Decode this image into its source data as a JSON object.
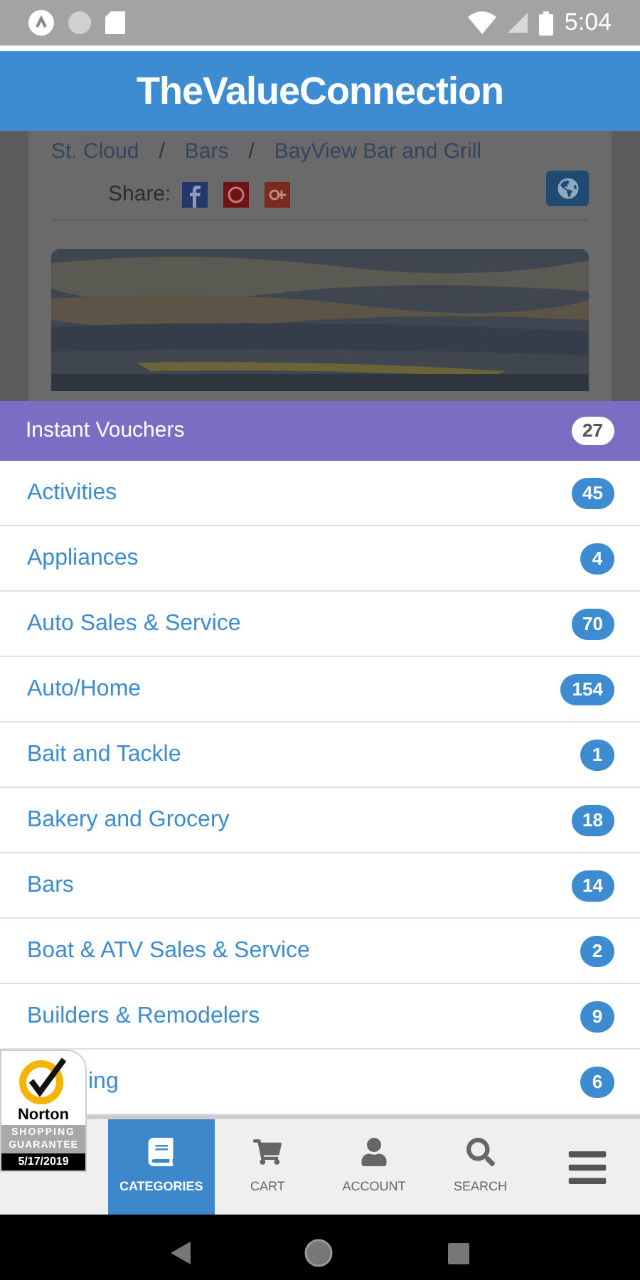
{
  "status_bar": {
    "time": "5:04"
  },
  "header": {
    "title": "TheValueConnection"
  },
  "background_page": {
    "breadcrumbs": [
      "St. Cloud",
      "Bars",
      "BayView Bar and Grill"
    ],
    "separator": "/",
    "share_label": "Share:"
  },
  "featured": {
    "label": "Instant Vouchers",
    "count": "27"
  },
  "categories": [
    {
      "label": "Activities",
      "count": "45",
      "kind": "full"
    },
    {
      "label": "Appliances",
      "count": "4",
      "kind": "full"
    },
    {
      "label": "Auto Sales & Service",
      "count": "70",
      "kind": "full"
    },
    {
      "label": "Auto/Home",
      "count": "154",
      "kind": "full"
    },
    {
      "label": "Bait and Tackle",
      "count": "1",
      "kind": "full"
    },
    {
      "label": "Bakery and Grocery",
      "count": "18",
      "kind": "full"
    },
    {
      "label": "Bars",
      "count": "14",
      "kind": "full"
    },
    {
      "label": "Boat & ATV Sales & Service",
      "count": "2",
      "kind": "full"
    },
    {
      "label": "Builders & Remodelers",
      "count": "9",
      "kind": "full"
    },
    {
      "label": "ing",
      "count": "6",
      "kind": "covered"
    }
  ],
  "badge": {
    "brand": "Norton",
    "line_1": "SHOPPING",
    "line_2": "GUARANTEE",
    "date": "5/17/2019"
  },
  "bottom_nav": [
    {
      "label": "CATEGORIES",
      "kind": "categories",
      "selected": true
    },
    {
      "label": "CART",
      "kind": "cart",
      "selected": false
    },
    {
      "label": "ACCOUNT",
      "kind": "account",
      "selected": false
    },
    {
      "label": "SEARCH",
      "kind": "search",
      "selected": false
    },
    {
      "kind": "menu",
      "selected": false
    }
  ]
}
